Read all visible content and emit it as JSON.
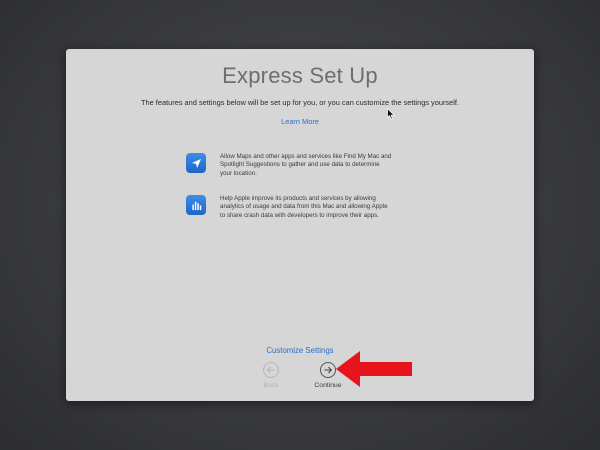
{
  "setup": {
    "title": "Express Set Up",
    "subtitle": "The features and settings below will be set up for you, or you can customize the settings yourself.",
    "learn_more": "Learn More",
    "features": [
      {
        "icon": "location-arrow-icon",
        "lines": [
          "Allow Maps and other apps and services like Find My Mac and",
          "Spotlight Suggestions to gather and use data to determine",
          "your location."
        ]
      },
      {
        "icon": "analytics-bars-icon",
        "lines": [
          "Help Apple improve its products and services by allowing",
          "analytics of usage and data from this Mac and allowing Apple",
          "to share crash data with developers to improve their apps."
        ]
      }
    ],
    "customize_settings": "Customize Settings",
    "back_label": "Back",
    "continue_label": "Continue"
  },
  "colors": {
    "accent_blue": "#2c6fc9",
    "annotation_arrow": "#e8141b",
    "window_bg": "#d6d6d6"
  }
}
